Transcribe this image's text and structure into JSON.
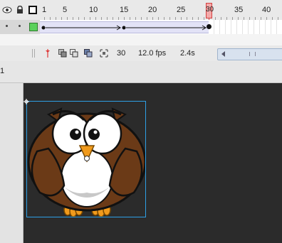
{
  "timeline": {
    "frame_numbers": [
      "1",
      "5",
      "10",
      "15",
      "20",
      "25",
      "30",
      "35",
      "40"
    ],
    "current_frame": "30",
    "frame_rate": "12.0 fps",
    "elapsed_time": "2.4s",
    "tween_color": "#e2e2f6",
    "playhead_color": "#d54040"
  },
  "edit_bar": {
    "scene_label": "1"
  },
  "stage": {
    "pasteboard_color": "#2b2b2b",
    "selection_color": "#2ea0e6"
  }
}
